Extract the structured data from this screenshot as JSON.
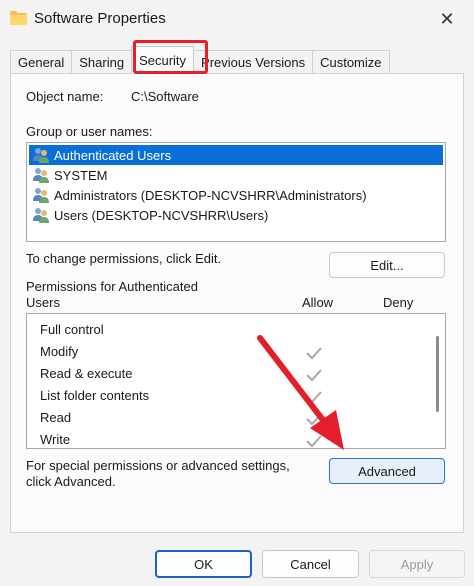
{
  "window": {
    "title": "Software Properties",
    "close_glyph": "✕"
  },
  "tabs": [
    {
      "label": "General"
    },
    {
      "label": "Sharing"
    },
    {
      "label": "Security",
      "active": true
    },
    {
      "label": "Previous Versions"
    },
    {
      "label": "Customize"
    }
  ],
  "object": {
    "label": "Object name:",
    "value": "C:\\Software"
  },
  "groups": {
    "label": "Group or user names:",
    "items": [
      "Authenticated Users",
      "SYSTEM",
      "Administrators (DESKTOP-NCVSHRR\\Administrators)",
      "Users (DESKTOP-NCVSHRR\\Users)"
    ],
    "selected_index": 0
  },
  "change": {
    "text": "To change permissions, click Edit.",
    "edit_label": "Edit..."
  },
  "permissions": {
    "label_line1": "Permissions for Authenticated",
    "label_line2": "Users",
    "allow_header": "Allow",
    "deny_header": "Deny",
    "rows": [
      {
        "name": "Full control",
        "allow": false,
        "deny": false
      },
      {
        "name": "Modify",
        "allow": true,
        "deny": false
      },
      {
        "name": "Read & execute",
        "allow": true,
        "deny": false
      },
      {
        "name": "List folder contents",
        "allow": true,
        "deny": false
      },
      {
        "name": "Read",
        "allow": true,
        "deny": false
      },
      {
        "name": "Write",
        "allow": true,
        "deny": false
      }
    ]
  },
  "special": {
    "line1": "For special permissions or advanced settings,",
    "line2": "click Advanced.",
    "advanced_label": "Advanced"
  },
  "footer": {
    "ok_label": "OK",
    "cancel_label": "Cancel",
    "apply_label": "Apply"
  },
  "colors": {
    "accent": "#0a6fd8",
    "highlight": "#e41e2b",
    "check": "#a8a8a8"
  },
  "icons": {
    "title": "folder-icon",
    "user": "users-group-icon",
    "check": "checkmark-icon"
  }
}
